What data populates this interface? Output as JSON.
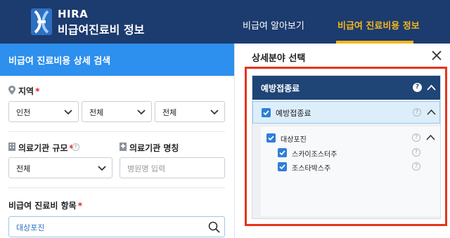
{
  "header": {
    "brand_en": "HIRA",
    "brand_ko": "비급여진료비 정보",
    "nav": [
      {
        "label": "비급여 알아보기",
        "active": false
      },
      {
        "label": "비급여 진료비용 정보",
        "active": true
      }
    ],
    "colors": {
      "bar": "#1c3b6e",
      "active": "#f4b81a"
    }
  },
  "search_panel": {
    "title": "비급여 진료비용 상세 검색",
    "region": {
      "label": "지역",
      "required_mark": "*",
      "selects": [
        "인천",
        "전체",
        "전체"
      ]
    },
    "scale": {
      "label": "의료기관 규모",
      "required_mark": "*",
      "value": "전체"
    },
    "name": {
      "label": "의료기관 명칭",
      "placeholder": "병원명 입력"
    },
    "item": {
      "label": "비급여 진료비 항목",
      "required_mark": "*",
      "value": "대상포진"
    },
    "accent_color": "#2d8fee"
  },
  "detail_panel": {
    "title": "상세분야 선택",
    "tree": {
      "header": "예방접종료",
      "level1": {
        "label": "예방접종료",
        "checked": true
      },
      "level2": {
        "label": "대상포진",
        "checked": true
      },
      "leaves": [
        {
          "label": "스카이조스터주",
          "checked": true
        },
        {
          "label": "조스타박스주",
          "checked": true
        }
      ],
      "help_glyph": "?"
    },
    "highlight_color": "#e6341a"
  }
}
